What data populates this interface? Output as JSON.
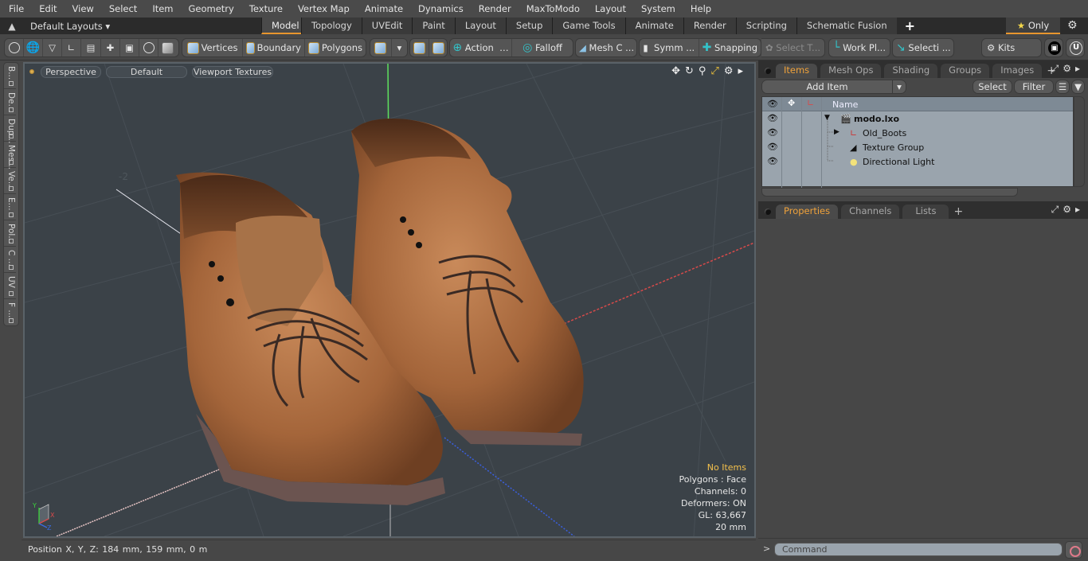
{
  "menu": [
    "File",
    "Edit",
    "View",
    "Select",
    "Item",
    "Geometry",
    "Texture",
    "Vertex Map",
    "Animate",
    "Dynamics",
    "Render",
    "MaxToModo",
    "Layout",
    "System",
    "Help"
  ],
  "layout_bar": {
    "layouts_label": "Default Layouts",
    "tabs": [
      "Model",
      "Topology",
      "UVEdit",
      "Paint",
      "Layout",
      "Setup",
      "Game Tools",
      "Animate",
      "Render",
      "Scripting",
      "Schematic Fusion"
    ],
    "active_tab": "Model",
    "only_label": "Only"
  },
  "toolbar": {
    "vertices": "Vertices",
    "boundary": "Boundary",
    "polygons": "Polygons",
    "action": "Action",
    "falloff": "Falloff",
    "mesh_c": "Mesh C ...",
    "symm": "Symm ...",
    "snapping": "Snapping",
    "select_t": "Select T...",
    "work_pl": "Work Pl...",
    "selecti": "Selecti ...",
    "kits": "Kits"
  },
  "side_tabs": [
    "B...",
    "De...",
    "Dup...",
    "Mes...",
    "Ve...",
    "E...",
    "Pol...",
    "C ...",
    "UV",
    "F ..."
  ],
  "viewport": {
    "view_mode": "Perspective",
    "shading": "Default",
    "textures": "Viewport Textures",
    "axis_label": "-2",
    "info": {
      "selection": "No Items",
      "polygons": "Polygons : Face",
      "channels": "Channels: 0",
      "deformers": "Deformers: ON",
      "gl": "GL: 63,667",
      "scale": "20 mm"
    },
    "gizmo": {
      "x": "X",
      "y": "Y",
      "z": "Z"
    }
  },
  "status": {
    "position": "Position X, Y, Z:   184 mm, 159 mm, 0 m"
  },
  "items_panel": {
    "tabs": [
      "Items",
      "Mesh Ops",
      "Shading",
      "Groups",
      "Images"
    ],
    "active_tab": "Items",
    "add_item": "Add Item",
    "select": "Select",
    "filter": "Filter",
    "column_name": "Name",
    "tree": [
      {
        "label": "modo.lxo",
        "level": 0,
        "bold": true,
        "icon": "scene-icon",
        "expanded": true
      },
      {
        "label": "Old_Boots",
        "level": 1,
        "icon": "locator-icon",
        "expandable": true
      },
      {
        "label": "Texture Group",
        "level": 1,
        "icon": "texture-group-icon"
      },
      {
        "label": "Directional Light",
        "level": 1,
        "icon": "light-icon"
      }
    ]
  },
  "properties_panel": {
    "tabs": [
      "Properties",
      "Channels",
      "Lists"
    ],
    "active_tab": "Properties"
  },
  "command": {
    "placeholder": "Command",
    "prompt": ">"
  },
  "colors": {
    "accent": "#e8962e",
    "active_tab_text": "#f0a23a",
    "viewport_bg": "#3b4248",
    "tree_bg": "#9aa4ad"
  }
}
